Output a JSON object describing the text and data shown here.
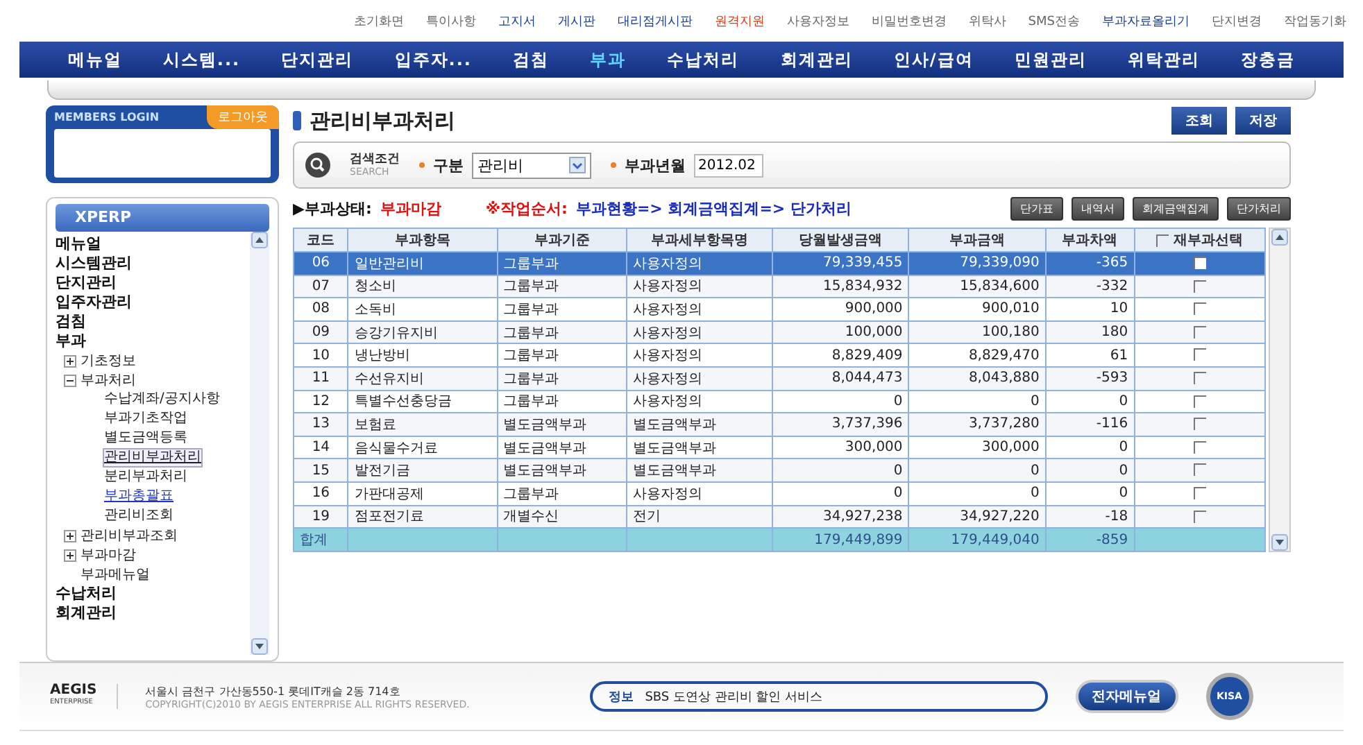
{
  "top_links": [
    {
      "label": "초기화면",
      "color": "#666666"
    },
    {
      "label": "특이사항",
      "color": "#666666"
    },
    {
      "label": "고지서",
      "color": "#1a3c8c"
    },
    {
      "label": "게시판",
      "color": "#1a3c8c"
    },
    {
      "label": "대리점게시판",
      "color": "#1a3c8c"
    },
    {
      "label": "원격지원",
      "color": "#d2401e"
    },
    {
      "label": "사용자정보",
      "color": "#666666"
    },
    {
      "label": "비밀번호변경",
      "color": "#666666"
    },
    {
      "label": "위탁사",
      "color": "#666666"
    },
    {
      "label": "SMS전송",
      "color": "#666666"
    },
    {
      "label": "부과자료올리기",
      "color": "#1a3c8c"
    },
    {
      "label": "단지변경",
      "color": "#666666"
    },
    {
      "label": "작업동기화",
      "color": "#666666"
    }
  ],
  "nav": [
    {
      "label": "메뉴얼",
      "selected": false
    },
    {
      "label": "시스템...",
      "selected": false
    },
    {
      "label": "단지관리",
      "selected": false
    },
    {
      "label": "입주자...",
      "selected": false
    },
    {
      "label": "검침",
      "selected": false
    },
    {
      "label": "부과",
      "selected": true
    },
    {
      "label": "수납처리",
      "selected": false
    },
    {
      "label": "회계관리",
      "selected": false
    },
    {
      "label": "인사/급여",
      "selected": false
    },
    {
      "label": "민원관리",
      "selected": false
    },
    {
      "label": "위탁관리",
      "selected": false
    },
    {
      "label": "장충금",
      "selected": false
    }
  ],
  "login": {
    "title": "MEMBERS LOGIN",
    "logout": "로그아웃"
  },
  "sidebar": {
    "title": "XPERP",
    "items": [
      {
        "label": "메뉴얼"
      },
      {
        "label": "시스템관리"
      },
      {
        "label": "단지관리"
      },
      {
        "label": "입주자관리"
      },
      {
        "label": "검침"
      },
      {
        "label": "부과",
        "children": [
          {
            "label": "기초정보",
            "expanded": false
          },
          {
            "label": "부과처리",
            "expanded": true,
            "children": [
              {
                "label": "수납계좌/공지사항",
                "selected": false,
                "highlighted": false
              },
              {
                "label": "부과기초작업",
                "selected": false,
                "highlighted": false
              },
              {
                "label": "별도금액등록",
                "selected": false,
                "highlighted": false
              },
              {
                "label": "관리비부과처리",
                "selected": true,
                "highlighted": false
              },
              {
                "label": "분리부과처리",
                "selected": false,
                "highlighted": false
              },
              {
                "label": "부과총괄표",
                "selected": false,
                "highlighted": true
              },
              {
                "label": "관리비조회",
                "selected": false,
                "highlighted": false
              }
            ]
          },
          {
            "label": "관리비부과조회",
            "expanded": false
          },
          {
            "label": "부과마감",
            "expanded": false
          },
          {
            "label": "부과메뉴얼"
          }
        ]
      },
      {
        "label": "수납처리"
      },
      {
        "label": "회계관리"
      }
    ]
  },
  "page_title": "관리비부과처리",
  "top_buttons": [
    "조회",
    "저장"
  ],
  "search": {
    "title": "검색조건",
    "subtitle": "SEARCH",
    "fields": [
      {
        "label": "구분",
        "kind": "select",
        "value": "관리비"
      },
      {
        "label": "부과년월",
        "kind": "text",
        "value": "2012.02"
      }
    ]
  },
  "status": {
    "label": "▶부과상태:",
    "value": "부과마감",
    "order_label": "※작업순서:",
    "order": "부과현황=> 회계금액집계=> 단가처리"
  },
  "action_buttons": [
    "단가표",
    "내역서",
    "회계금액집계",
    "단가처리"
  ],
  "table": {
    "columns": [
      "코드",
      "부과항목",
      "부과기준",
      "부과세부항목명",
      "당월발생금액",
      "부과금액",
      "부과차액",
      "재부과선택"
    ],
    "header_checked": false,
    "rows": [
      {
        "cells": [
          "06",
          "일반관리비",
          "그룹부과",
          "사용자정의",
          "79,339,455",
          "79,339,090",
          "-365"
        ],
        "checked": false,
        "selected": true
      },
      {
        "cells": [
          "07",
          "청소비",
          "그룹부과",
          "사용자정의",
          "15,834,932",
          "15,834,600",
          "-332"
        ],
        "checked": false,
        "selected": false
      },
      {
        "cells": [
          "08",
          "소독비",
          "그룹부과",
          "사용자정의",
          "900,000",
          "900,010",
          "10"
        ],
        "checked": false,
        "selected": false
      },
      {
        "cells": [
          "09",
          "승강기유지비",
          "그룹부과",
          "사용자정의",
          "100,000",
          "100,180",
          "180"
        ],
        "checked": false,
        "selected": false
      },
      {
        "cells": [
          "10",
          "냉난방비",
          "그룹부과",
          "사용자정의",
          "8,829,409",
          "8,829,470",
          "61"
        ],
        "checked": false,
        "selected": false
      },
      {
        "cells": [
          "11",
          "수선유지비",
          "그룹부과",
          "사용자정의",
          "8,044,473",
          "8,043,880",
          "-593"
        ],
        "checked": false,
        "selected": false
      },
      {
        "cells": [
          "12",
          "특별수선충당금",
          "그룹부과",
          "사용자정의",
          "0",
          "0",
          "0"
        ],
        "checked": false,
        "selected": false
      },
      {
        "cells": [
          "13",
          "보험료",
          "별도금액부과",
          "별도금액부과",
          "3,737,396",
          "3,737,280",
          "-116"
        ],
        "checked": false,
        "selected": false
      },
      {
        "cells": [
          "14",
          "음식물수거료",
          "별도금액부과",
          "별도금액부과",
          "300,000",
          "300,000",
          "0"
        ],
        "checked": false,
        "selected": false
      },
      {
        "cells": [
          "15",
          "발전기금",
          "별도금액부과",
          "별도금액부과",
          "0",
          "0",
          "0"
        ],
        "checked": false,
        "selected": false
      },
      {
        "cells": [
          "16",
          "가판대공제",
          "그룹부과",
          "사용자정의",
          "0",
          "0",
          "0"
        ],
        "checked": false,
        "selected": false
      },
      {
        "cells": [
          "19",
          "점포전기료",
          "개별수신",
          "전기",
          "34,927,238",
          "34,927,220",
          "-18"
        ],
        "checked": false,
        "selected": false
      }
    ],
    "total": [
      "합계",
      "179,449,899",
      "179,449,040",
      "-859"
    ]
  },
  "footer": {
    "logo": "AEGIS",
    "logo_sub": "ENTERPRISE",
    "address": "서울시 금천구 가산동550-1 롯데IT캐슬 2동 714호",
    "copyright": "COPYRIGHT(C)2010 BY AEGIS ENTERPRISE ALL RIGHTS RESERVED.",
    "ticker": [
      {
        "label": "정보",
        "text": "SBS 도연상 관리비 할인 서비스"
      }
    ],
    "manual_button": "전자메뉴얼",
    "badge": "KISA"
  }
}
